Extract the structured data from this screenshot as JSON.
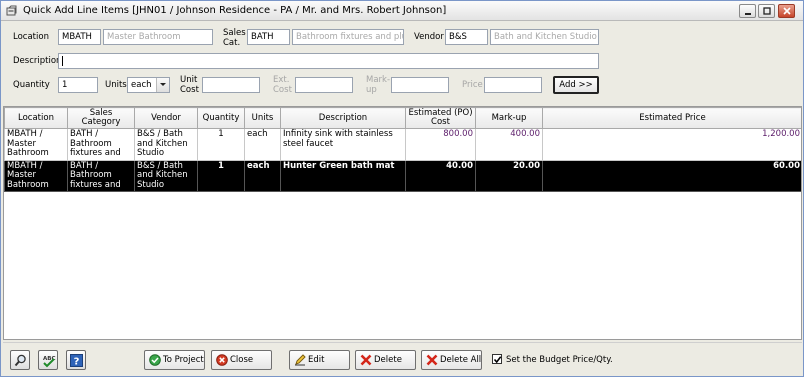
{
  "window": {
    "title": "Quick Add Line Items [JHN01 / Johnson Residence - PA / Mr. and Mrs. Robert Johnson]"
  },
  "form": {
    "location_label": "Location",
    "location_code": "MBATH",
    "location_name": "Master Bathroom",
    "salescat_label_1": "Sales",
    "salescat_label_2": "Cat.",
    "salescat_code": "BATH",
    "salescat_name": "Bathroom fixtures and plumbir",
    "vendor_label": "Vendor",
    "vendor_code": "B&S",
    "vendor_name": "Bath and Kitchen Studio",
    "description_label": "Description",
    "description_value": "",
    "quantity_label": "Quantity",
    "quantity_value": "1",
    "units_label": "Units",
    "units_value": "each",
    "unitcost_label_1": "Unit",
    "unitcost_label_2": "Cost",
    "unitcost_value": "",
    "extcost_label_1": "Ext.",
    "extcost_label_2": "Cost",
    "extcost_value": "",
    "markup_label_1": "Mark-",
    "markup_label_2": "up",
    "markup_value": "",
    "price_label": "Price",
    "price_value": "",
    "add_button": "Add >>"
  },
  "grid": {
    "columns": [
      "Location",
      "Sales Category",
      "Vendor",
      "Quantity",
      "Units",
      "Description",
      "Estimated (PO) Cost",
      "Mark-up",
      "Estimated Price"
    ],
    "rows": [
      {
        "location": "MBATH / Master Bathroom",
        "category": "BATH / Bathroom fixtures and",
        "vendor": "B&S / Bath and Kitchen Studio",
        "quantity": "1",
        "units": "each",
        "description": "Infinity sink with stainless steel faucet",
        "cost": "800.00",
        "markup": "400.00",
        "price": "1,200.00",
        "selected": false
      },
      {
        "location": "MBATH / Master Bathroom",
        "category": "BATH / Bathroom fixtures and",
        "vendor": "B&S / Bath and Kitchen Studio",
        "quantity": "1",
        "units": "each",
        "description": "Hunter Green bath mat",
        "cost": "40.00",
        "markup": "20.00",
        "price": "60.00",
        "selected": true
      }
    ]
  },
  "footer": {
    "search_icon": "magnifier-icon",
    "spell_icon": "spellcheck-icon",
    "help_icon": "help-icon",
    "to_project": "To Project",
    "close": "Close",
    "edit": "Edit",
    "delete": "Delete",
    "delete_all": "Delete All",
    "budget_checkbox_label": "Set the Budget Price/Qty.",
    "budget_checked": true
  },
  "colors": {
    "window_bg": "#ecebe3",
    "selected_row": "#000000",
    "value_text": "#5a1a68",
    "close_button": "#c6452b"
  }
}
